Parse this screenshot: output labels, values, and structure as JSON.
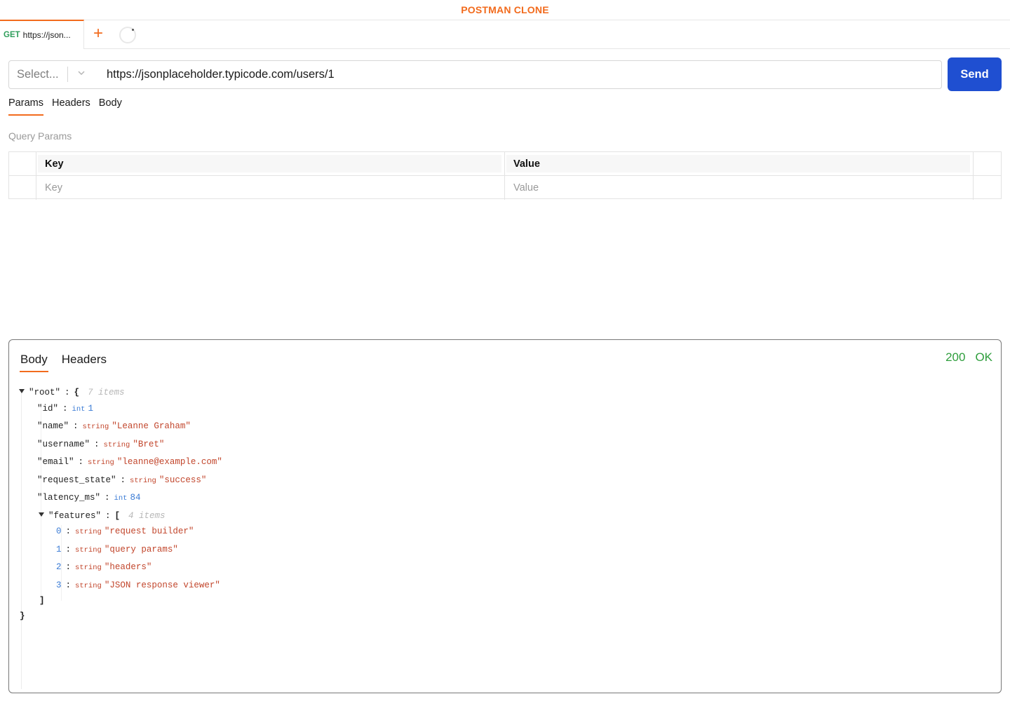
{
  "app": {
    "title": "POSTMAN CLONE"
  },
  "tabs": [
    {
      "method": "GET",
      "label": "https://json..."
    }
  ],
  "new_tab_icon": "plus-icon",
  "loading_icon": "spinner-icon",
  "request": {
    "method_placeholder": "Select...",
    "url": "https://jsonplaceholder.typicode.com/users/1",
    "send_label": "Send"
  },
  "request_tabs": [
    "Params",
    "Headers",
    "Body"
  ],
  "active_request_tab": "Params",
  "query_params": {
    "section_label": "Query Params",
    "columns": [
      "Key",
      "Value"
    ],
    "rows": [
      {
        "key_placeholder": "Key",
        "value_placeholder": "Value"
      }
    ]
  },
  "response": {
    "tabs": [
      "Body",
      "Headers"
    ],
    "active_tab": "Body",
    "status_code": "200",
    "status_text": "OK",
    "root": {
      "key": "\"root\"",
      "meta": "7 items"
    },
    "fields": [
      {
        "key": "\"id\"",
        "type": "int",
        "value": "1"
      },
      {
        "key": "\"name\"",
        "type": "string",
        "value": "\"Leanne Graham\""
      },
      {
        "key": "\"username\"",
        "type": "string",
        "value": "\"Bret\""
      },
      {
        "key": "\"email\"",
        "type": "string",
        "value": "\"leanne@example.com\""
      },
      {
        "key": "\"request_state\"",
        "type": "string",
        "value": "\"success\""
      },
      {
        "key": "\"latency_ms\"",
        "type": "int",
        "value": "84"
      }
    ],
    "features": {
      "key": "\"features\"",
      "meta": "4 items",
      "items": [
        {
          "index": "0",
          "type": "string",
          "value": "\"request builder\""
        },
        {
          "index": "1",
          "type": "string",
          "value": "\"query params\""
        },
        {
          "index": "2",
          "type": "string",
          "value": "\"headers\""
        },
        {
          "index": "3",
          "type": "string",
          "value": "\"JSON response viewer\""
        }
      ]
    },
    "punct": {
      "colon": ":",
      "open_obj": "{",
      "close_obj": "}",
      "open_arr": "[",
      "close_arr": "]"
    }
  }
}
